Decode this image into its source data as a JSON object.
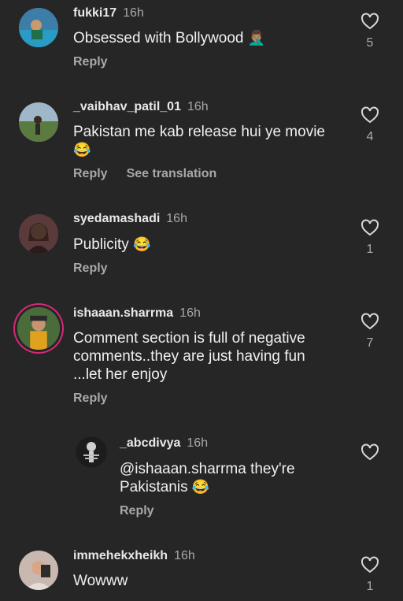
{
  "comments": [
    {
      "user": "fukki17",
      "time": "16h",
      "text": "Obsessed with Bollywood",
      "emoji": "🤦🏽‍♂️",
      "reply": "Reply",
      "likes": "5",
      "avatar": "swimmer-photo"
    },
    {
      "user": "_vaibhav_patil_01",
      "time": "16h",
      "text": "Pakistan me kab release hui ye movie",
      "emoji": "😂",
      "reply": "Reply",
      "translate": "See translation",
      "likes": "4",
      "avatar": "landscape-photo"
    },
    {
      "user": "syedamashadi",
      "time": "16h",
      "text": "Publicity",
      "emoji": "😂",
      "reply": "Reply",
      "likes": "1",
      "avatar": "woman-photo"
    },
    {
      "user": "ishaaan.sharrma",
      "time": "16h",
      "text": "Comment section is full of negative comments..they are just having fun ...let her enjoy",
      "reply": "Reply",
      "likes": "7",
      "avatar": "man-photo"
    },
    {
      "user": "_abcdivya",
      "time": "16h",
      "text": "@ishaaan.sharrma they're Pakistanis",
      "emoji": "😂",
      "reply": "Reply",
      "likes": "",
      "avatar": "skeleton-photo"
    },
    {
      "user": "immehekxheikh",
      "time": "16h",
      "text": "Wowww",
      "likes": "1",
      "avatar": "selfie-photo"
    }
  ],
  "colors": {
    "background": "#262626",
    "ring": "#d62976"
  }
}
